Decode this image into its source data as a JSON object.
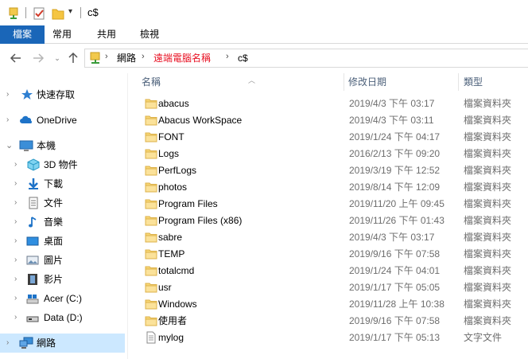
{
  "window": {
    "title": "c$"
  },
  "ribbon": {
    "tabs": [
      {
        "label": "檔案"
      },
      {
        "label": "常用"
      },
      {
        "label": "共用"
      },
      {
        "label": "檢視"
      }
    ]
  },
  "address": {
    "crumbs": [
      {
        "label": "網路"
      },
      {
        "label": "遠端電腦名稱"
      },
      {
        "label": "c$"
      }
    ],
    "highlight_color": "#e81123"
  },
  "sidebar": {
    "items": [
      {
        "label": "快速存取",
        "icon": "star-icon"
      },
      {
        "label": "OneDrive",
        "icon": "cloud-icon"
      },
      {
        "label": "本機",
        "icon": "computer-icon"
      },
      {
        "label": "3D 物件",
        "icon": "cube-icon"
      },
      {
        "label": "下載",
        "icon": "download-icon"
      },
      {
        "label": "文件",
        "icon": "document-icon"
      },
      {
        "label": "音樂",
        "icon": "music-icon"
      },
      {
        "label": "桌面",
        "icon": "desktop-icon"
      },
      {
        "label": "圖片",
        "icon": "pictures-icon"
      },
      {
        "label": "影片",
        "icon": "videos-icon"
      },
      {
        "label": "Acer (C:)",
        "icon": "drive-icon"
      },
      {
        "label": "Data (D:)",
        "icon": "drive-icon"
      },
      {
        "label": "網路",
        "icon": "network-icon"
      }
    ]
  },
  "columns": {
    "name": "名稱",
    "date": "修改日期",
    "type": "類型"
  },
  "files": [
    {
      "name": "abacus",
      "date": "2019/4/3 下午 03:17",
      "type": "檔案資料夾",
      "kind": "folder"
    },
    {
      "name": "Abacus WorkSpace",
      "date": "2019/4/3 下午 03:11",
      "type": "檔案資料夾",
      "kind": "folder"
    },
    {
      "name": "FONT",
      "date": "2019/1/24 下午 04:17",
      "type": "檔案資料夾",
      "kind": "folder"
    },
    {
      "name": "Logs",
      "date": "2016/2/13 下午 09:20",
      "type": "檔案資料夾",
      "kind": "folder"
    },
    {
      "name": "PerfLogs",
      "date": "2019/3/19 下午 12:52",
      "type": "檔案資料夾",
      "kind": "folder"
    },
    {
      "name": "photos",
      "date": "2019/8/14 下午 12:09",
      "type": "檔案資料夾",
      "kind": "folder"
    },
    {
      "name": "Program Files",
      "date": "2019/11/20 上午 09:45",
      "type": "檔案資料夾",
      "kind": "folder"
    },
    {
      "name": "Program Files (x86)",
      "date": "2019/11/26 下午 01:43",
      "type": "檔案資料夾",
      "kind": "folder"
    },
    {
      "name": "sabre",
      "date": "2019/4/3 下午 03:17",
      "type": "檔案資料夾",
      "kind": "folder"
    },
    {
      "name": "TEMP",
      "date": "2019/9/16 下午 07:58",
      "type": "檔案資料夾",
      "kind": "folder"
    },
    {
      "name": "totalcmd",
      "date": "2019/1/24 下午 04:01",
      "type": "檔案資料夾",
      "kind": "folder"
    },
    {
      "name": "usr",
      "date": "2019/1/17 下午 05:05",
      "type": "檔案資料夾",
      "kind": "folder"
    },
    {
      "name": "Windows",
      "date": "2019/11/28 上午 10:38",
      "type": "檔案資料夾",
      "kind": "folder"
    },
    {
      "name": "使用者",
      "date": "2019/9/16 下午 07:58",
      "type": "檔案資料夾",
      "kind": "folder"
    },
    {
      "name": "mylog",
      "date": "2019/1/17 下午 05:13",
      "type": "文字文件",
      "kind": "text"
    }
  ]
}
